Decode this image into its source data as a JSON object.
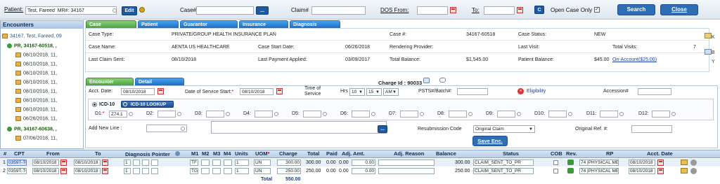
{
  "topbar": {
    "patient_label": "Patient:",
    "patient_value": "Test, Fareed  MR#: 34167",
    "edit_label": "Edit",
    "case_label": "Case#",
    "case_value": "",
    "case_btn": "...",
    "claim_label": "Claim#",
    "claim_value": "",
    "dos_from_label": "DOS From:",
    "dos_from_value": "",
    "to_label": "To:",
    "to_value": "",
    "c_label": "C",
    "open_case_label": "Open Case Only",
    "search_label": "Search",
    "close_label": "Close"
  },
  "sidebar": {
    "title": "Encounters",
    "patient_node": "34167, Test, Fareed, 09",
    "pr1": "PR, 34167-60518, ,",
    "items1": [
      "08/10/2018, 11,",
      "08/10/2018, 11,",
      "08/10/2018, 11,",
      "08/10/2018, 11,",
      "08/10/2018, 11,",
      "08/10/2018, 11,",
      "08/10/2018, 11,",
      "06/26/2018, 11,"
    ],
    "pr2": "PR, 34167-60638, ,",
    "items2": [
      "07/06/2018, 11,"
    ]
  },
  "case_tabs": [
    "Case",
    "Patient",
    "Guarantor",
    "Insurance",
    "Diagnosis"
  ],
  "case": {
    "case_type_label": "Case Type:",
    "case_type_value": "PRIVATE/GROUP HEALTH INSURANCE PLAN",
    "case_no_label": "Case #:",
    "case_no_value": "34167-60518",
    "case_status_label": "Case Status:",
    "case_status_value": "NEW",
    "case_name_label": "Case Name:",
    "case_name_value": "AENTA US HEALTHCARE",
    "start_date_label": "Case Start Date:",
    "start_date_value": "06/26/2018",
    "rendering_label": "Rendering Provider:",
    "last_visit_label": "Last Visit:",
    "total_visits_label": "Total Visits:",
    "total_visits_value": "7",
    "last_claim_label": "Last Claim Sent:",
    "last_claim_value": "08/10/2018",
    "last_payment_label": "Last Payment Applied:",
    "last_payment_value": "03/09/2017",
    "total_balance_label": "Total Balance:",
    "total_balance_value": "$1,545.00",
    "patient_balance_label": "Patient Balance:",
    "patient_balance_value": "$45.00",
    "on_account_label": "On-Account($25.00)"
  },
  "side_letters": [
    "K",
    "B",
    "Y"
  ],
  "enc_tabs": [
    "Encounter",
    "Detail"
  ],
  "encounter": {
    "charge_id_label": "Charge Id : 90033",
    "acct_date_label": "Acct. Date:",
    "acct_date_value": "08/10/2018",
    "dos_start_label": "Date of Service Start:",
    "dos_start_value": "08/10/2018",
    "time_label": "Time of Service",
    "hrs_label": "Hrs",
    "hrs_value": "10",
    "min_value": "15",
    "ampm_value": "AM",
    "psts_label": "PSTS#/Batch#:",
    "eligibility_label": "Eligibility",
    "accession_label": "Accession#",
    "icd10_label": "ICD-10",
    "icd10_lookup": "ICD-10 LOOKUP",
    "dx_labels": [
      "D1:",
      "D2:",
      "D3:",
      "D4:",
      "D5:",
      "D6:",
      "D7:",
      "D8:",
      "D9:",
      "D10:",
      "D11:",
      "D12:"
    ],
    "d1_value": "Z74.1",
    "add_line_label": "Add New Line :",
    "resub_label": "Resubmission Code",
    "resub_value": "Original Claim",
    "orig_ref_label": "Original Ref. #:",
    "save_label": "Save Enc."
  },
  "grid": {
    "headers": [
      "#",
      "CPT",
      "From",
      "To",
      "Diagnosis Pointer",
      "M1",
      "M2",
      "M3",
      "M4",
      "Units",
      "UOM",
      "Charge",
      "Total",
      "Paid",
      "Adj. Amt.",
      "Adj. Reason",
      "Balance",
      "Status",
      "COB",
      "Rev.",
      "RP",
      "Acct. Date"
    ],
    "rows": [
      {
        "no": "1",
        "cpt": "0359T-T0",
        "from": "08/10/2018",
        "to": "08/10/2018",
        "dp": "1",
        "m1": "TF",
        "units": "1",
        "uom": "UN",
        "charge": "300.00",
        "total": "300.00",
        "paid": "0.00",
        "adj": "0.00",
        "adj_amt": "0.00",
        "balance": "300.00",
        "status": "CLAIM_SENT_TO_PR",
        "rp": "74 |PHYSICAL MEC",
        "acct": "08/10/2018"
      },
      {
        "no": "2",
        "cpt": "0359T-TG",
        "from": "08/10/2018",
        "to": "08/10/2018",
        "dp": "1",
        "m1": "TG",
        "units": "1",
        "uom": "UN",
        "charge": "250.00",
        "total": "250.00",
        "paid": "0.00",
        "adj": "0.00",
        "adj_amt": "0.00",
        "balance": "250.00",
        "status": "CLAIM_SENT_TO_PR",
        "rp": "74 |PHYSICAL MEC",
        "acct": "08/10/2018"
      }
    ],
    "total_label": "Total",
    "total_value": "550.00"
  }
}
